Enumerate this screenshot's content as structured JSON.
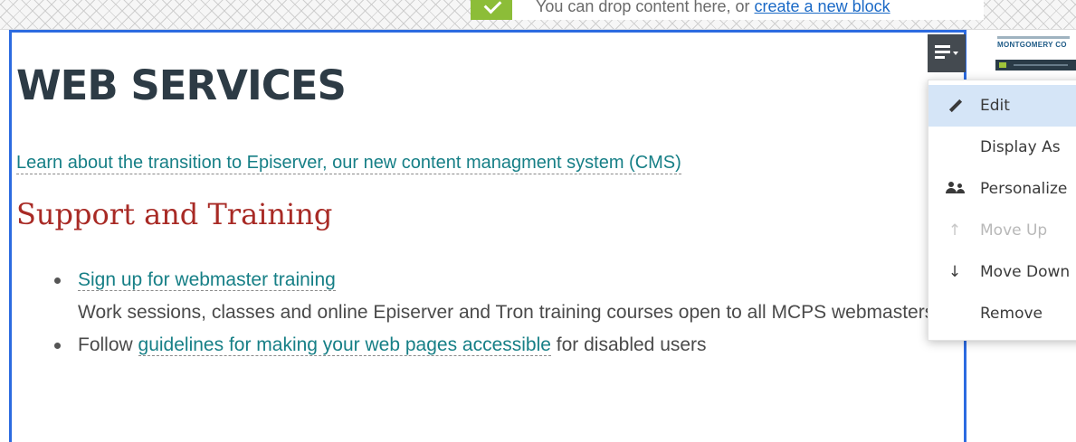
{
  "dropzone": {
    "message": "You can drop content here, or ",
    "link": "create a new block"
  },
  "block": {
    "title": "WEB SERVICES",
    "intro_link": "Learn about the transition to Episerver, our new content managment system (CMS)",
    "section_heading": "Support and Training",
    "items": [
      {
        "link": "Sign up for webmaster training",
        "description": "Work sessions, classes and online Episerver and Tron training courses open to all MCPS webmasters"
      },
      {
        "prefix": "Follow ",
        "link": "guidelines for making your web pages accessible",
        "suffix": " for disabled users"
      }
    ]
  },
  "thumbnail": {
    "brand": "MONTGOMERY CO"
  },
  "context_menu": {
    "items": [
      {
        "label": "Edit",
        "icon": "pencil-icon",
        "state": "active"
      },
      {
        "label": "Display As",
        "icon": "",
        "state": "normal"
      },
      {
        "label": "Personalize",
        "icon": "users-icon",
        "state": "normal"
      },
      {
        "label": "Move Up",
        "icon": "arrow-up-icon",
        "state": "disabled"
      },
      {
        "label": "Move Down",
        "icon": "arrow-down-icon",
        "state": "normal"
      },
      {
        "label": "Remove",
        "icon": "",
        "state": "normal"
      }
    ]
  },
  "colors": {
    "frame": "#2c6be0",
    "title": "#2d3b45",
    "heading": "#a82a25",
    "link": "#167f86",
    "menu_active": "#d5e5f7"
  }
}
